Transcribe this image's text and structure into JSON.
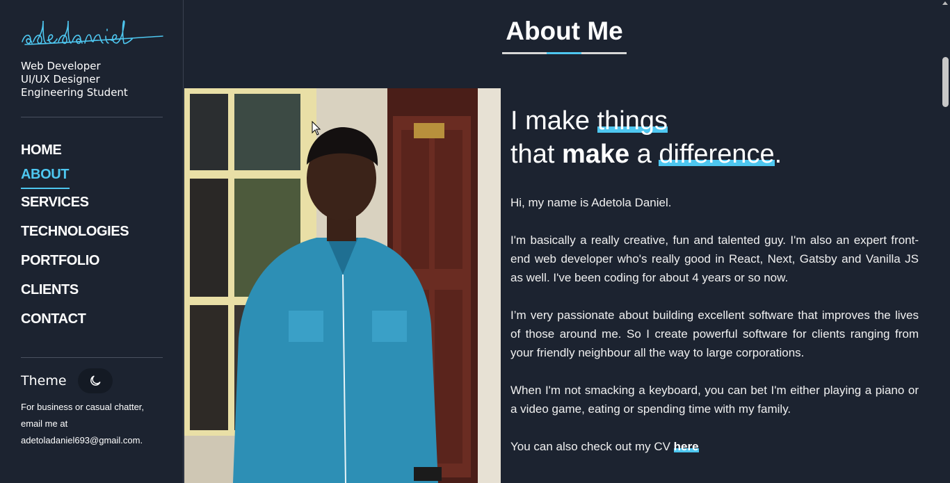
{
  "sidebar": {
    "logo_text": "adedaniel",
    "roles": [
      "Web Developer",
      "UI/UX Designer",
      "Engineering Student"
    ],
    "nav": [
      {
        "label": "HOME",
        "active": false
      },
      {
        "label": "ABOUT",
        "active": true
      },
      {
        "label": "SERVICES",
        "active": false
      },
      {
        "label": "TECHNOLOGIES",
        "active": false
      },
      {
        "label": "PORTFOLIO",
        "active": false
      },
      {
        "label": "CLIENTS",
        "active": false
      },
      {
        "label": "CONTACT",
        "active": false
      }
    ],
    "theme_label": "Theme",
    "theme_icon": "moon-icon",
    "contact_note": {
      "line1": "For business or casual chatter,",
      "line2": "email me at",
      "email": "adetoladaniel693@gmail.com."
    }
  },
  "main": {
    "section_title": "About Me",
    "headline": {
      "w1": "I make ",
      "w2": "things",
      "w3": "that ",
      "w4": "make",
      "w5": " a ",
      "w6": "difference",
      "w7": "."
    },
    "paragraphs": [
      "Hi, my name is Adetola Daniel.",
      "I'm basically a really creative, fun and talented guy. I'm also an expert front-end web developer who's really good in React, Next, Gatsby and Vanilla JS as well. I've been coding for about 4 years or so now.",
      "I’m very passionate about building excellent software that improves the lives of those around me. So I create powerful software for clients ranging from your friendly neighbour all the way to large corporations.",
      "When I'm not smacking a keyboard, you can bet I'm either playing a piano or a video game, eating or spending time with my family."
    ],
    "cv_text": "You can also check out my CV ",
    "cv_link": "here"
  },
  "colors": {
    "background": "#1c2330",
    "accent": "#4ec7f0",
    "text": "#ffffff"
  }
}
